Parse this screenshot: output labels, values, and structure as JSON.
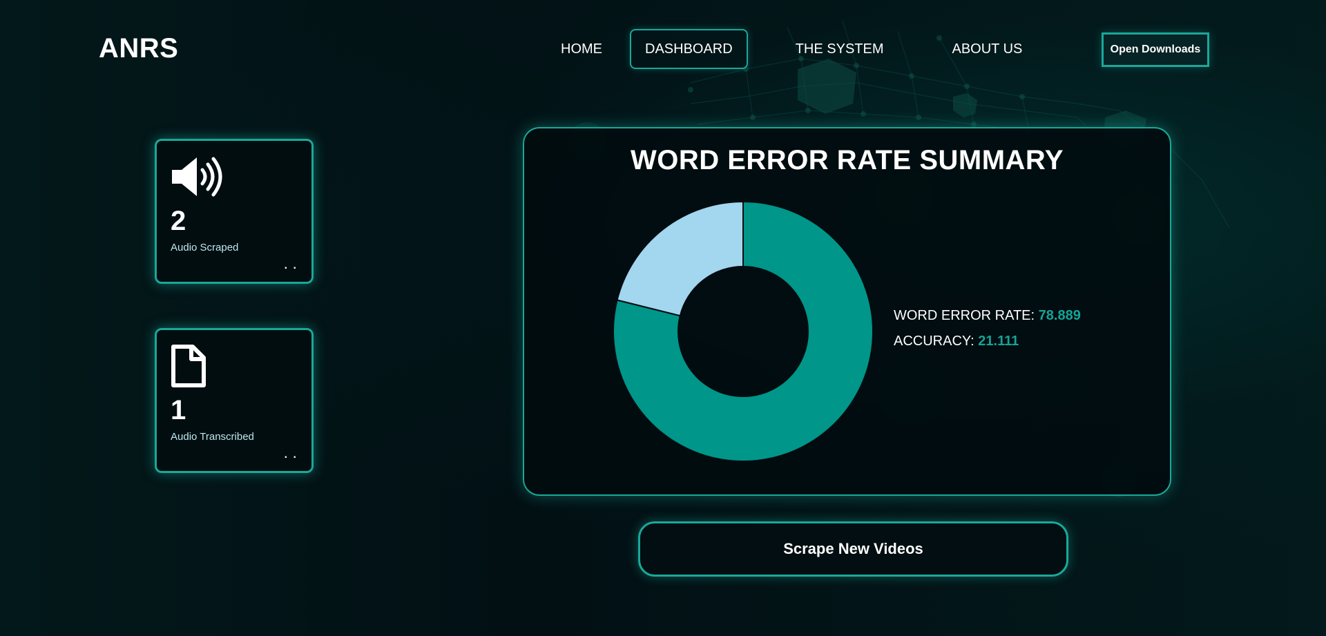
{
  "nav": {
    "brand": "ANRS",
    "items": [
      {
        "label": "HOME"
      },
      {
        "label": "DASHBOARD"
      },
      {
        "label": "THE SYSTEM"
      },
      {
        "label": "ABOUT US"
      }
    ],
    "active": "DASHBOARD",
    "downloads_label": "Open Downloads"
  },
  "stats": [
    {
      "icon": "speaker-icon",
      "value": "2",
      "label": "Audio Scraped",
      "menu": ". ."
    },
    {
      "icon": "document-icon",
      "value": "1",
      "label": "Audio Transcribed",
      "menu": ". ."
    }
  ],
  "wer_summary": {
    "title": "WORD ERROR RATE SUMMARY",
    "wer_label": "WORD ERROR RATE:",
    "wer_value": "78.889",
    "accuracy_label": "ACCURACY:",
    "accuracy_value": "21.111"
  },
  "chart_data": {
    "type": "pie",
    "categories": [
      "WORD ERROR RATE",
      "ACCURACY"
    ],
    "values": [
      78.889,
      21.111
    ],
    "colors": [
      "#00968a",
      "#a3d6ef"
    ],
    "title": "WORD ERROR RATE SUMMARY"
  },
  "actions": {
    "scrape_label": "Scrape New Videos"
  },
  "colors": {
    "accent": "#1aa89a",
    "value_text": "#14a596",
    "background": "#021014"
  }
}
